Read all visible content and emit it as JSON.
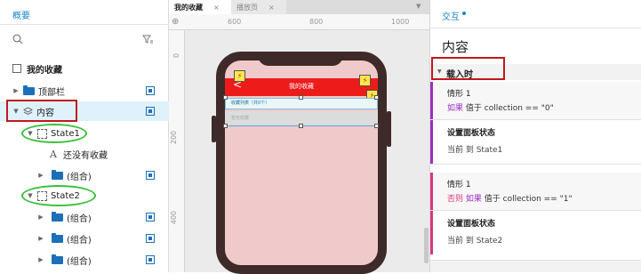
{
  "outline": {
    "title": "概要",
    "search_icon": "search-icon",
    "filter_icon": "filter-icon",
    "items": [
      {
        "label": "我的收藏",
        "icon": "page-icon"
      },
      {
        "label": "顶部栏",
        "icon": "folder-icon"
      },
      {
        "label": "内容",
        "icon": "dynamic-panel-icon"
      },
      {
        "label": "State1",
        "icon": "state-icon"
      },
      {
        "label": "还没有收藏",
        "icon": "text-icon"
      },
      {
        "label": "(组合)",
        "icon": "folder-icon"
      },
      {
        "label": "State2",
        "icon": "state-icon"
      },
      {
        "label": "(组合)",
        "icon": "folder-icon"
      },
      {
        "label": "(组合)",
        "icon": "folder-icon"
      },
      {
        "label": "(组合)",
        "icon": "folder-icon"
      }
    ]
  },
  "tabs": [
    {
      "label": "我的收藏",
      "close": "×"
    },
    {
      "label": "播放页",
      "close": "×"
    }
  ],
  "ruler": {
    "h_ticks": [
      "600",
      "800",
      "1000"
    ],
    "v_ticks": [
      "0",
      "200",
      "400"
    ]
  },
  "phone": {
    "title": "我的收藏",
    "back": "<",
    "bolt": "⚡",
    "list_label": "收藏列表（共0个）",
    "empty_label": "暂无收藏"
  },
  "inspector": {
    "tab": "交互",
    "widget_name": "内容",
    "event": "载入时",
    "cases": [
      {
        "title": "情形 1",
        "keyword": "如果",
        "condition": "值于 collection == \"0\"",
        "action_title": "设置面板状态",
        "action_body": "当前 到 State1",
        "bar_color": "#9b2fc0"
      },
      {
        "title": "情形 1",
        "keyword_else": "否则",
        "keyword": "如果",
        "condition": "值于 collection == \"1\"",
        "action_title": "设置面板状态",
        "action_body": "当前 到 State2",
        "bar_color": "#d8387a"
      }
    ]
  }
}
